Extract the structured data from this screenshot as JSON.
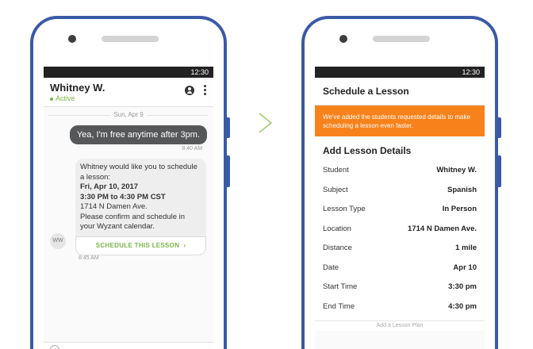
{
  "left_phone": {
    "status_time": "12:30",
    "header": {
      "name": "Whitney W.",
      "status": "Active"
    },
    "date_divider": "Sun, Apr 9",
    "outgoing": {
      "text": "Yea, I'm free anytime after 3pm.",
      "time": "8:40 AM"
    },
    "incoming": {
      "intro": "Whitney would like you to schedule a lesson:",
      "date": "Fri, Apr 10, 2017",
      "time_range": "3:30 PM to 4:30 PM CST",
      "address": "1714 N Damen Ave.",
      "note": "Please confirm and schedule in your Wyzant calendar.",
      "button_label": "SCHEDULE THIS LESSON",
      "time": "8:45 AM",
      "avatar_initials": "WW"
    }
  },
  "right_phone": {
    "status_time": "12:30",
    "title": "Schedule a Lesson",
    "notice": "We've added the students requested details to make scheduling a lesson even faster.",
    "section_title": "Add Lesson Details",
    "details": [
      {
        "label": "Student",
        "value": "Whitney W."
      },
      {
        "label": "Subject",
        "value": "Spanish"
      },
      {
        "label": "Lesson Type",
        "value": "In Person"
      },
      {
        "label": "Location",
        "value": "1714 N Damen Ave."
      },
      {
        "label": "Distance",
        "value": "1 mile"
      },
      {
        "label": "Date",
        "value": "Apr 10"
      },
      {
        "label": "Start Time",
        "value": "3:30 pm"
      },
      {
        "label": "End Time",
        "value": "4:30 pm"
      }
    ],
    "plan_button": "Add a Lesson Plan"
  },
  "colors": {
    "phone_frame": "#3a5aa6",
    "accent_green": "#7ab648",
    "notice_orange": "#f7821b",
    "outgoing_bubble": "#555759"
  }
}
